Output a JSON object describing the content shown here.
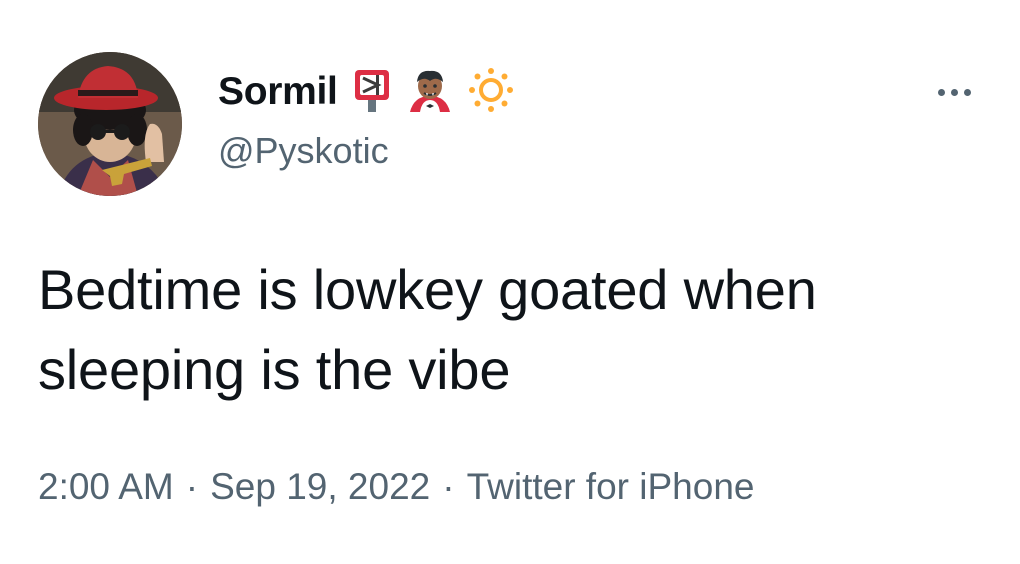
{
  "author": {
    "display_name": "Sormil",
    "handle": "@Pyskotic",
    "name_emojis": [
      "postbox-icon",
      "vampire-icon",
      "sun-icon"
    ]
  },
  "tweet": {
    "text": "Bedtime is lowkey goated when sleeping is the vibe",
    "time": "2:00 AM",
    "date": "Sep 19, 2022",
    "source": "Twitter for iPhone",
    "separator": "·"
  },
  "colors": {
    "text_primary": "#0f1419",
    "text_secondary": "#536471",
    "background": "#ffffff"
  },
  "icons": {
    "more": "more-options-icon",
    "avatar": "user-avatar"
  }
}
